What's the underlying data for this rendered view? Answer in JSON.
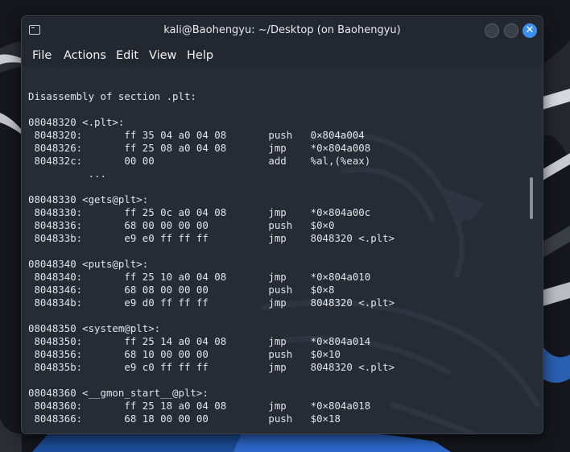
{
  "window": {
    "title": "kali@Baohengyu: ~/Desktop (on Baohengyu)",
    "close_glyph": "✕"
  },
  "menu": [
    "File",
    "Actions",
    "Edit",
    "View",
    "Help"
  ],
  "terminal": {
    "lines": [
      "",
      "Disassembly of section .plt:",
      "",
      "08048320 <.plt>:",
      " 8048320:       ff 35 04 a0 04 08       push   0×804a004",
      " 8048326:       ff 25 08 a0 04 08       jmp    *0×804a008",
      " 804832c:       00 00                   add    %al,(%eax)",
      "          ...",
      "",
      "08048330 <gets@plt>:",
      " 8048330:       ff 25 0c a0 04 08       jmp    *0×804a00c",
      " 8048336:       68 00 00 00 00          push   $0×0",
      " 804833b:       e9 e0 ff ff ff          jmp    8048320 <.plt>",
      "",
      "08048340 <puts@plt>:",
      " 8048340:       ff 25 10 a0 04 08       jmp    *0×804a010",
      " 8048346:       68 08 00 00 00          push   $0×8",
      " 804834b:       e9 d0 ff ff ff          jmp    8048320 <.plt>",
      "",
      "08048350 <system@plt>:",
      " 8048350:       ff 25 14 a0 04 08       jmp    *0×804a014",
      " 8048356:       68 10 00 00 00          push   $0×10",
      " 804835b:       e9 c0 ff ff ff          jmp    8048320 <.plt>",
      "",
      "08048360 <__gmon_start__@plt>:",
      " 8048360:       ff 25 18 a0 04 08       jmp    *0×804a018",
      " 8048366:       68 18 00 00 00          push   $0×18"
    ]
  },
  "icons": {
    "app": "terminal-icon",
    "minimize": "minimize-icon",
    "maximize": "maximize-icon",
    "close": "close-icon"
  },
  "colors": {
    "window_bg": "#232830",
    "terminal_bg": "#262b34",
    "text": "#e2e4e8",
    "close_accent": "#3c8fe8"
  }
}
